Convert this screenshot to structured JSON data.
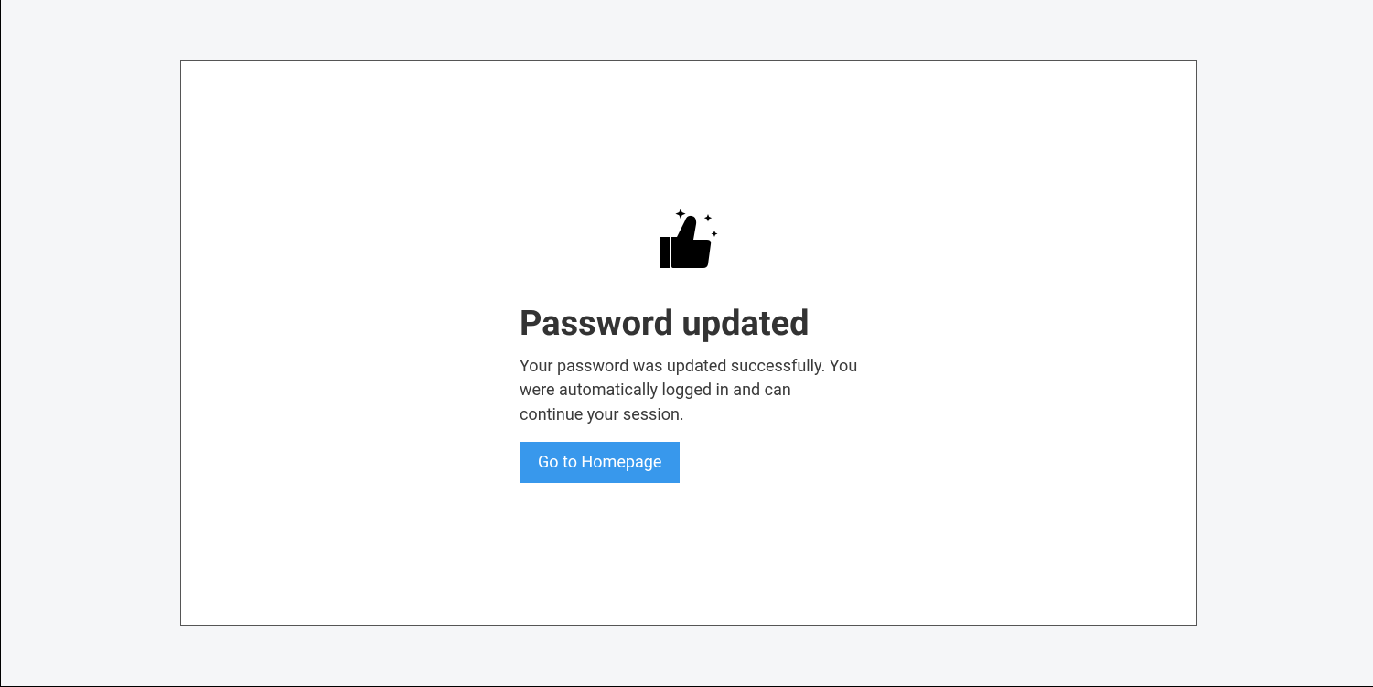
{
  "main": {
    "title": "Password updated",
    "description": "Your password was updated successfully. You were automatically logged in and can continue your session.",
    "button_label": "Go to Homepage"
  },
  "colors": {
    "accent": "#3898ec",
    "text": "#333333",
    "background": "#f5f6f8"
  }
}
